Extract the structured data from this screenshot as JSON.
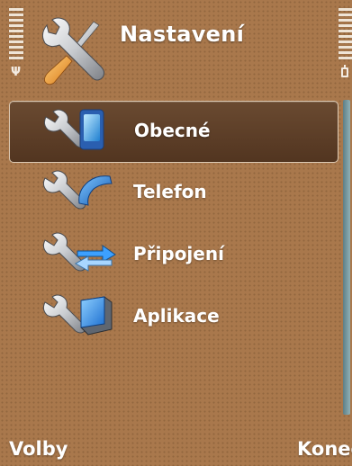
{
  "header": {
    "title": "Nastavení",
    "title_icon": "settings-tools-icon",
    "signal_icon": "signal-antenna-icon",
    "battery_icon": "battery-icon"
  },
  "list": {
    "items": [
      {
        "label": "Obecné",
        "icon": "general-phone-settings-icon",
        "selected": true
      },
      {
        "label": "Telefon",
        "icon": "telephone-settings-icon",
        "selected": false
      },
      {
        "label": "Připojení",
        "icon": "connection-settings-icon",
        "selected": false
      },
      {
        "label": "Aplikace",
        "icon": "application-settings-icon",
        "selected": false
      }
    ]
  },
  "softkeys": {
    "left": "Volby",
    "right": "Konec"
  },
  "colors": {
    "background": "#a9784c",
    "highlight": "#5e3f28",
    "text": "#ffffff",
    "scrollbar": "#7a9aa0"
  }
}
